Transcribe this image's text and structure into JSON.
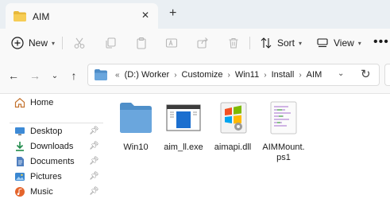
{
  "tab": {
    "title": "AIM",
    "close_glyph": "✕",
    "new_tab_glyph": "+"
  },
  "commands": {
    "new_label": "New",
    "sort_label": "Sort",
    "view_label": "View",
    "more_glyph": "•••"
  },
  "address": {
    "prefix": "«",
    "crumbs": [
      "(D:) Worker",
      "Customize",
      "Win11",
      "Install",
      "AIM"
    ],
    "separator": "›"
  },
  "sidebar": {
    "items": [
      {
        "label": "Home",
        "icon": "home-icon",
        "pinned": false
      },
      {
        "label": "Desktop",
        "icon": "desktop-icon",
        "pinned": true
      },
      {
        "label": "Downloads",
        "icon": "downloads-icon",
        "pinned": true
      },
      {
        "label": "Documents",
        "icon": "documents-icon",
        "pinned": true
      },
      {
        "label": "Pictures",
        "icon": "pictures-icon",
        "pinned": true
      },
      {
        "label": "Music",
        "icon": "music-icon",
        "pinned": true
      }
    ]
  },
  "files": [
    {
      "name": "Win10",
      "type": "folder"
    },
    {
      "name": "aim_ll.exe",
      "type": "exe"
    },
    {
      "name": "aimapi.dll",
      "type": "dll"
    },
    {
      "name": "AIMMount.\nps1",
      "line1": "AIMMount.",
      "line2": "ps1",
      "type": "script"
    }
  ],
  "colors": {
    "folder": "#5f9fd6",
    "accent": "#0067c0",
    "titlebar_bg": "#eaeff3"
  }
}
